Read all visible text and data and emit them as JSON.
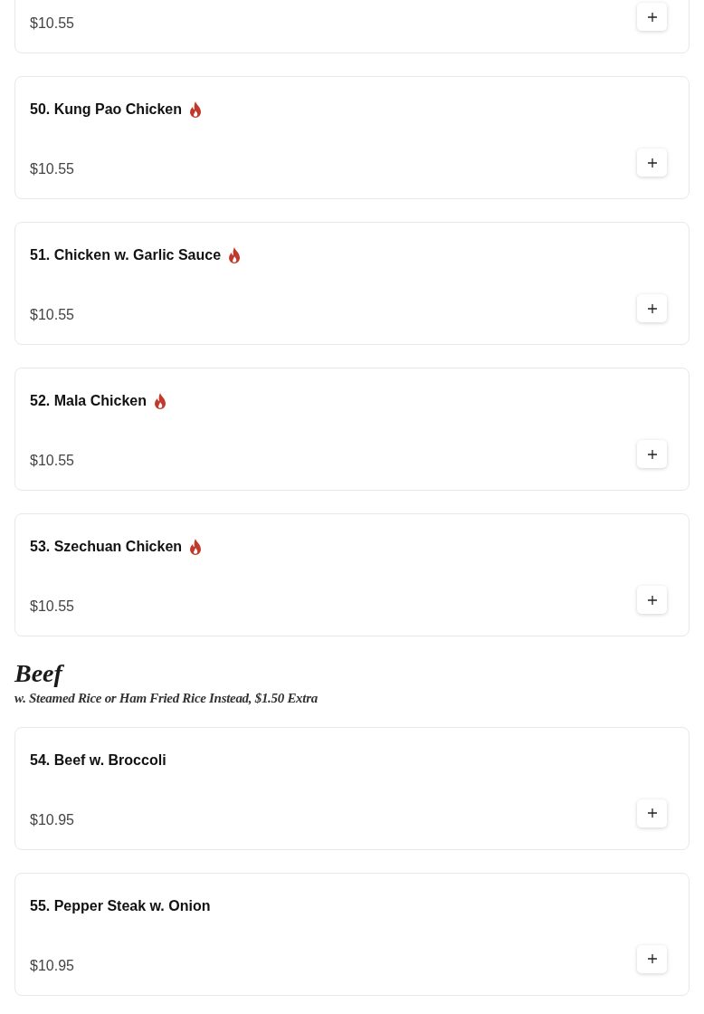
{
  "sections": [
    {
      "items": [
        {
          "price": "$10.55"
        }
      ]
    },
    {
      "items": [
        {
          "name": "50. Kung Pao Chicken",
          "spicy": true,
          "price": "$10.55"
        },
        {
          "name": "51. Chicken w. Garlic Sauce",
          "spicy": true,
          "price": "$10.55"
        },
        {
          "name": "52. Mala Chicken",
          "spicy": true,
          "price": "$10.55"
        },
        {
          "name": "53. Szechuan Chicken",
          "spicy": true,
          "price": "$10.55"
        }
      ]
    },
    {
      "title": "Beef",
      "subtitle": "w. Steamed Rice or Ham Fried Rice Instead, $1.50 Extra",
      "items": [
        {
          "name": "54. Beef w. Broccoli",
          "spicy": false,
          "price": "$10.95"
        },
        {
          "name": "55. Pepper Steak w. Onion",
          "spicy": false,
          "price": "$10.95"
        }
      ]
    }
  ]
}
